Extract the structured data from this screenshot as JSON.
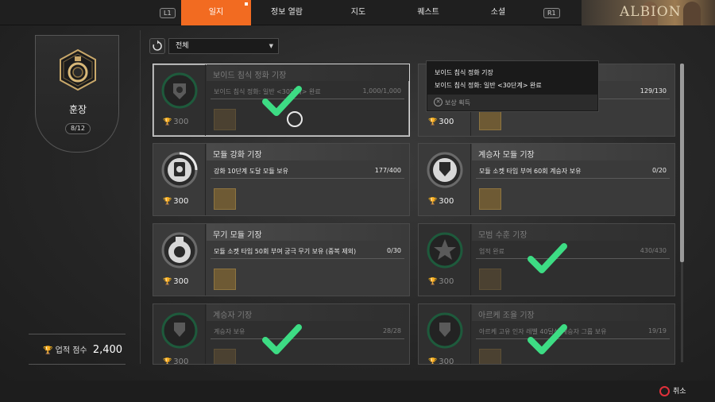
{
  "nav": {
    "left_button": "L1",
    "right_button": "R1",
    "tabs": [
      {
        "label": "일지",
        "active": true
      },
      {
        "label": "정보 열람",
        "active": false
      },
      {
        "label": "지도",
        "active": false
      },
      {
        "label": "퀘스트",
        "active": false
      },
      {
        "label": "소셜",
        "active": false
      }
    ],
    "banner_text": "ALBION",
    "accent_color": "#f26b21"
  },
  "left_panel": {
    "title": "훈장",
    "count": "8/12",
    "score_label": "업적 점수",
    "score_value": "2,400"
  },
  "filter": {
    "selected": "전체"
  },
  "cards": [
    {
      "title": "보이드 침식 정화 기장",
      "condition": "보이드 침식 정화: 일반 <30단계> 완료",
      "progress": "1,000/1,000",
      "points": "300",
      "completed": true,
      "selected": true
    },
    {
      "title": "",
      "condition": "",
      "progress": "129/130",
      "points": "300",
      "completed": false,
      "selected": false
    },
    {
      "title": "모듈 강화 기장",
      "condition": "강화 10단계 도달 모듈 보유",
      "progress": "177/400",
      "points": "300",
      "completed": false,
      "selected": false
    },
    {
      "title": "계승자 모듈 기장",
      "condition": "모듈 소켓 타입 부여 60회 계승자 보유",
      "progress": "0/20",
      "points": "300",
      "completed": false,
      "selected": false
    },
    {
      "title": "무기 모듈 기장",
      "condition": "모듈 소켓 타입 50회 부여 궁극 무기 보유 (중복 제외)",
      "progress": "0/30",
      "points": "300",
      "completed": false,
      "selected": false
    },
    {
      "title": "모범 수훈 기장",
      "condition": "업적 완료",
      "progress": "430/430",
      "points": "300",
      "completed": true,
      "selected": false
    },
    {
      "title": "계승자 기장",
      "condition": "계승자 보유",
      "progress": "28/28",
      "points": "300",
      "completed": true,
      "selected": false
    },
    {
      "title": "아르케 조율 기장",
      "condition": "아르케 고유 인자 레벨 40달성 계승자 그룹 보유",
      "progress": "19/19",
      "points": "300",
      "completed": true,
      "selected": false
    }
  ],
  "tooltip": {
    "title": "보이드 침식 정화 기장",
    "description": "보이드 침식 정화: 일반 <30단계> 완료",
    "reward_label": "보상 획득"
  },
  "footer": {
    "cancel_label": "취소"
  },
  "colors": {
    "check_green": "#3ddc84",
    "medal_ring_green": "#1e7a4c"
  }
}
